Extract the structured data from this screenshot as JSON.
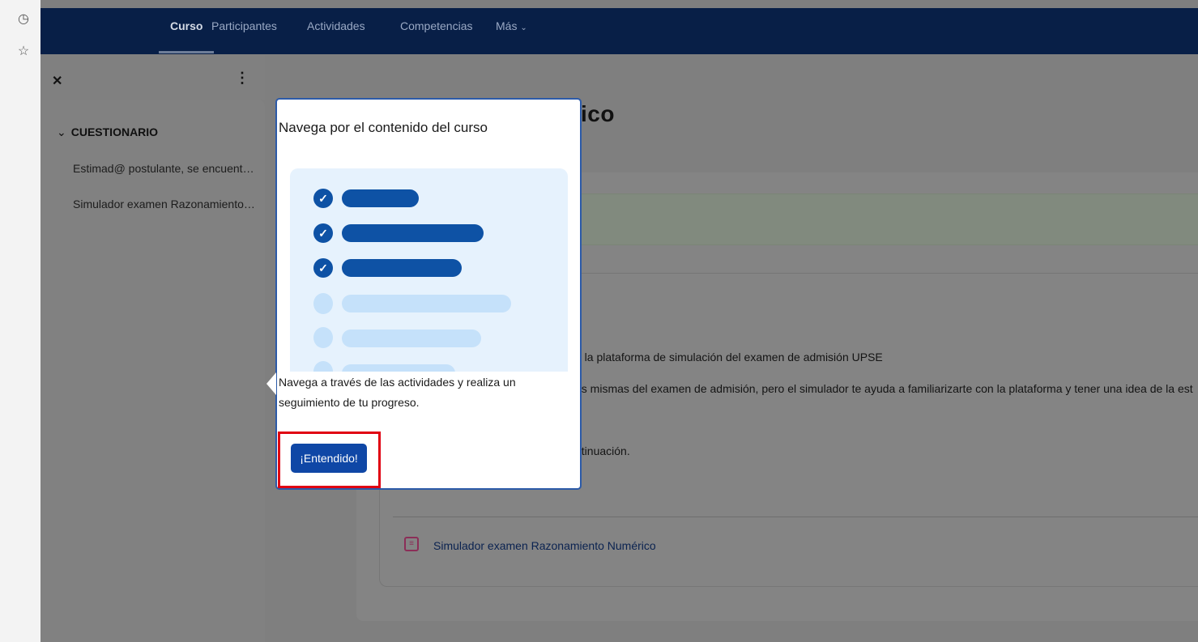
{
  "nav": {
    "items": [
      {
        "label": "Curso",
        "active": true
      },
      {
        "label": "Participantes",
        "active": false
      },
      {
        "label": "Actividades",
        "active": false
      },
      {
        "label": "Competencias",
        "active": false
      }
    ],
    "more_label": "Más"
  },
  "drawer": {
    "section_title": "CUESTIONARIO",
    "items": [
      "Estimad@ postulante, se encuentra en la plataforma de simulación del examen de admisión UPSE",
      "Simulador examen Razonamiento Numérico"
    ]
  },
  "main": {
    "title_visible_right": "ico",
    "line1": "n la plataforma de simulación del examen de admisión UPSE",
    "line2": "as mismas del examen de admisión, pero el simulador te ayuda a familiarizarte con la plataforma y tener una idea de la est",
    "line3": "ntinuación.",
    "activity_link": "Simulador examen Razonamiento Numérico"
  },
  "tour": {
    "title": "Navega por el contenido del curso",
    "body": "Navega a través de las actividades y realiza un seguimiento de tu progreso.",
    "button_label": "¡Entendido!",
    "highlight_color": "#e00012"
  },
  "colors": {
    "nav_bg": "#081f47",
    "accent": "#0f47a6",
    "illustration_bg": "#e6f2fd"
  }
}
